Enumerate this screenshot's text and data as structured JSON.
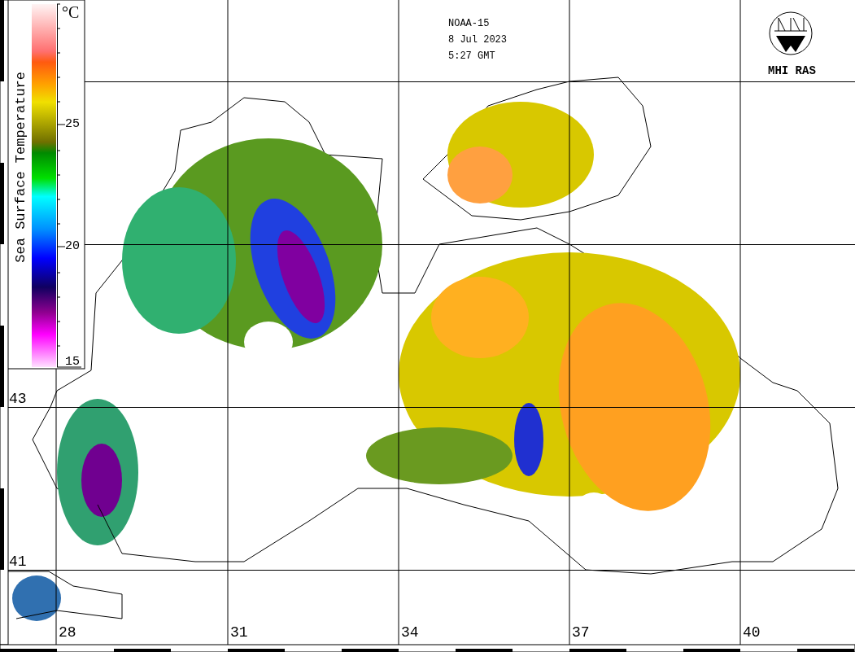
{
  "header": {
    "satellite": "NOAA-15",
    "date": "8 Jul 2023",
    "time": "5:27 GMT"
  },
  "logo": {
    "label": "MHI RAS"
  },
  "colorbar": {
    "title": "Sea Surface Temperature",
    "unit": "°C",
    "ticks": [
      "25",
      "20",
      "15"
    ]
  },
  "latitude_labels": [
    "43",
    "41"
  ],
  "longitude_labels": [
    "28",
    "31",
    "34",
    "37",
    "40"
  ]
}
